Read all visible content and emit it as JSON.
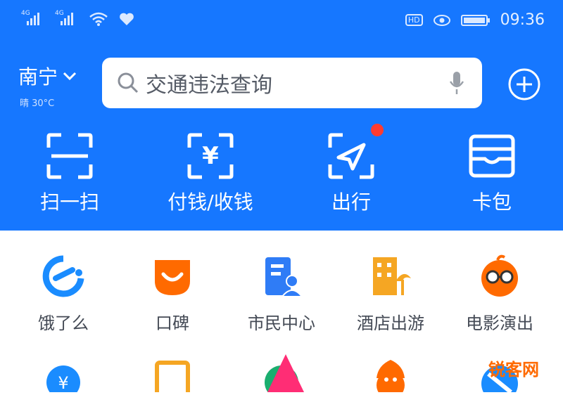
{
  "status_bar": {
    "sim1_tag": "4G",
    "sim2_tag": "4G",
    "time": "09:36",
    "hd_badge": "HD"
  },
  "header": {
    "city": "南宁",
    "weather": "晴 30°C",
    "search_placeholder": "交通违法查询"
  },
  "quick_actions": [
    {
      "label": "扫一扫",
      "icon": "scan-icon"
    },
    {
      "label": "付钱/收钱",
      "icon": "pay-icon"
    },
    {
      "label": "出行",
      "icon": "travel-icon"
    },
    {
      "label": "卡包",
      "icon": "card-wallet-icon"
    }
  ],
  "apps": [
    {
      "label": "饿了么",
      "icon": "eleme-icon",
      "color": "#1a8cff"
    },
    {
      "label": "口碑",
      "icon": "koubei-icon",
      "color": "#ff6a00"
    },
    {
      "label": "市民中心",
      "icon": "citizen-center-icon",
      "color": "#2f7cf6"
    },
    {
      "label": "酒店出游",
      "icon": "hotel-travel-icon",
      "color": "#f5a623"
    },
    {
      "label": "电影演出",
      "icon": "movie-show-icon",
      "color": "#ff6a00"
    }
  ],
  "watermark": "锐客网",
  "colors": {
    "brand_blue": "#1677ff",
    "badge_red": "#ff3b30"
  }
}
